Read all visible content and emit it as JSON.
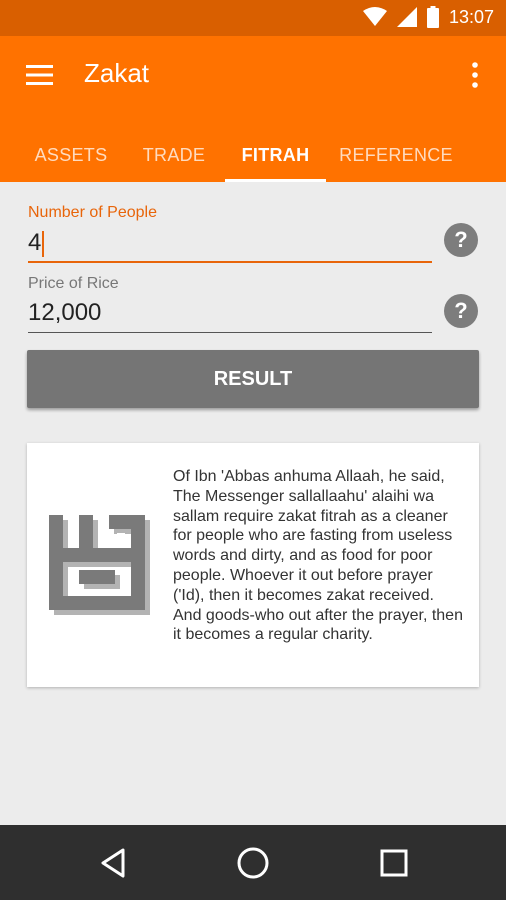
{
  "status_bar": {
    "time": "13:07",
    "icons": [
      "wifi-icon",
      "cellular-signal-icon",
      "battery-icon"
    ]
  },
  "app_bar": {
    "title": "Zakat",
    "menu_icon": "hamburger-menu-icon",
    "overflow_icon": "more-vert-icon"
  },
  "tabs": [
    {
      "label": "ASSETS",
      "active": false
    },
    {
      "label": "TRADE",
      "active": false
    },
    {
      "label": "FITRAH",
      "active": true
    },
    {
      "label": "REFERENCE",
      "active": false
    }
  ],
  "form": {
    "people": {
      "label": "Number of People",
      "value": "4"
    },
    "rice": {
      "label": "Price of Rice",
      "value": "12,000"
    }
  },
  "result_label": "RESULT",
  "card": {
    "text": "Of Ibn 'Abbas anhuma Allaah, he said, The Messenger sallallaahu' alaihi wa sallam require zakat fitrah as a cleaner for people who are fasting from useless words and dirty, and as food for poor people. Whoever it out before prayer ('Id), then it becomes zakat received. And goods-who out after the prayer, then it becomes a regular charity."
  },
  "colors": {
    "accent": "#ff7200",
    "status_bar": "#d95f00",
    "focus": "#e8650a",
    "button": "#757575"
  },
  "nav": [
    "back-icon",
    "home-icon",
    "recents-icon"
  ]
}
